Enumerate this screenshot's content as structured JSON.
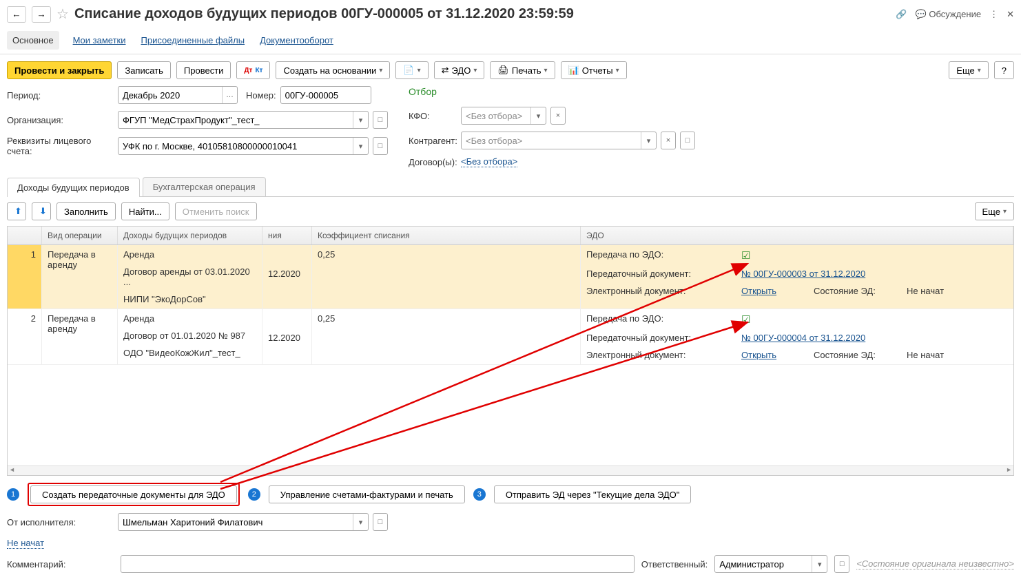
{
  "header": {
    "title": "Списание доходов будущих периодов 00ГУ-000005 от 31.12.2020 23:59:59",
    "discuss": "Обсуждение"
  },
  "nav": {
    "main": "Основное",
    "notes": "Мои заметки",
    "files": "Присоединенные файлы",
    "flow": "Документооборот"
  },
  "toolbar": {
    "post_close": "Провести и закрыть",
    "record": "Записать",
    "post": "Провести",
    "create_based": "Создать на основании",
    "edo": "ЭДО",
    "print": "Печать",
    "reports": "Отчеты",
    "more": "Еще",
    "help": "?"
  },
  "form": {
    "period_label": "Период:",
    "period_value": "Декабрь 2020",
    "number_label": "Номер:",
    "number_value": "00ГУ-000005",
    "org_label": "Организация:",
    "org_value": "ФГУП \"МедСтрахПродукт\"_тест_",
    "account_label": "Реквизиты лицевого счета:",
    "account_value": "УФК по г. Москве, 40105810800000010041"
  },
  "filter": {
    "title": "Отбор",
    "kfo_label": "КФО:",
    "kfo_value": "<Без отбора>",
    "contr_label": "Контрагент:",
    "contr_value": "<Без отбора>",
    "contract_label": "Договор(ы):",
    "contract_link": "<Без отбора>"
  },
  "tabs2": {
    "income": "Доходы будущих периодов",
    "accounting": "Бухгалтерская операция"
  },
  "table_toolbar": {
    "fill": "Заполнить",
    "find": "Найти...",
    "cancel_find": "Отменить поиск",
    "more": "Еще"
  },
  "table": {
    "headers": {
      "op": "Вид операции",
      "income": "Доходы будущих периодов",
      "rep": "ния",
      "coef": "Коэффициент списания",
      "edo": "ЭДО"
    },
    "rows": [
      {
        "n": "1",
        "op": "Передача в аренду",
        "inc1": "Аренда",
        "inc2": "Договор аренды от 03.01.2020 ...",
        "inc3": "НИПИ \"ЭкоДорСов\"",
        "rep": "12.2020",
        "coef": "0,25",
        "edo_transfer_label": "Передача по ЭДО:",
        "edo_doc_label": "Передаточный документ:",
        "edo_doc_link": "№ 00ГУ-000003 от 31.12.2020",
        "edo_el_label": "Электронный документ:",
        "edo_open": "Открыть",
        "edo_state_label": "Состояние ЭД:",
        "edo_state": "Не начат"
      },
      {
        "n": "2",
        "op": "Передача в аренду",
        "inc1": "Аренда",
        "inc2": "Договор от 01.01.2020 № 987",
        "inc3": "ОДО \"ВидеоКожЖил\"_тест_",
        "rep": "12.2020",
        "coef": "0,25",
        "edo_transfer_label": "Передача по ЭДО:",
        "edo_doc_label": "Передаточный документ:",
        "edo_doc_link": "№ 00ГУ-000004 от 31.12.2020",
        "edo_el_label": "Электронный документ:",
        "edo_open": "Открыть",
        "edo_state_label": "Состояние ЭД:",
        "edo_state": "Не начат"
      }
    ]
  },
  "actions": {
    "create_docs": "Создать передаточные документы для ЭДО",
    "manage_invoices": "Управление счетами-фактурами и печать",
    "send_ed": "Отправить ЭД через \"Текущие дела ЭДО\""
  },
  "bottom": {
    "exec_label": "От исполнителя:",
    "exec_value": "Шмельман Харитоний Филатович",
    "not_started": "Не начат",
    "comment_label": "Комментарий:",
    "resp_label": "Ответственный:",
    "resp_value": "Администратор",
    "orig_state": "<Состояние оригинала неизвестно>"
  }
}
